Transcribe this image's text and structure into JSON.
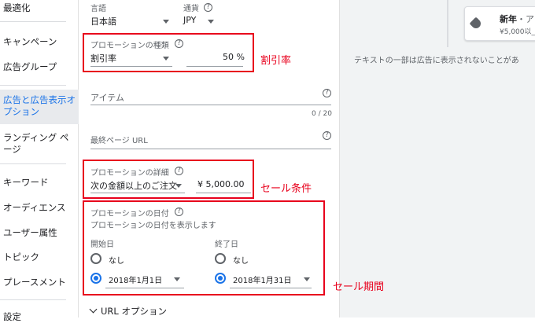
{
  "sidebar": {
    "items": [
      {
        "label": "最適化"
      },
      {
        "label": "キャンペーン"
      },
      {
        "label": "広告グループ"
      },
      {
        "label": "広告と広告表示オ"
      },
      {
        "label": "プション"
      },
      {
        "label": "ランディング ペ"
      },
      {
        "label": "ージ"
      },
      {
        "label": "キーワード"
      },
      {
        "label": "オーディエンス"
      },
      {
        "label": "ユーザー属性"
      },
      {
        "label": "トピック"
      },
      {
        "label": "プレースメント"
      },
      {
        "label": "設定"
      }
    ]
  },
  "form": {
    "language_label": "言語",
    "language_value": "日本語",
    "currency_label": "通貨",
    "currency_value": "JPY",
    "promo_type_label": "プロモーションの種類",
    "promo_type_value": "割引率",
    "promo_percent": "50 %",
    "item_placeholder": "アイテム",
    "item_counter": "0 / 20",
    "final_url_placeholder": "最終ページ URL",
    "promo_detail_label": "プロモーションの詳細",
    "promo_detail_value": "次の金額以上のご注文",
    "promo_amount": "¥ 5,000.00",
    "promo_date_label": "プロモーションの日付",
    "promo_date_sub": "プロモーションの日付を表示します",
    "start_label": "開始日",
    "end_label": "終了日",
    "none_label": "なし",
    "start_date": "2018年1月1日",
    "end_date": "2018年1月31日",
    "url_options": "URL オプション"
  },
  "annotations": {
    "discount": "割引率",
    "sale_condition": "セール条件",
    "sale_period": "セール期間"
  },
  "preview": {
    "card_title": "新年",
    "card_title_rest": "・ア",
    "card_sub": "¥5,000以_",
    "note": "テキストの一部は広告に表示されないことがあ"
  },
  "colors": {
    "accent": "#1a73e8",
    "annotation_red": "#e8001c"
  },
  "icons": [
    "help-icon",
    "tag-icon",
    "chevron-down-icon",
    "dropdown-caret-icon"
  ]
}
